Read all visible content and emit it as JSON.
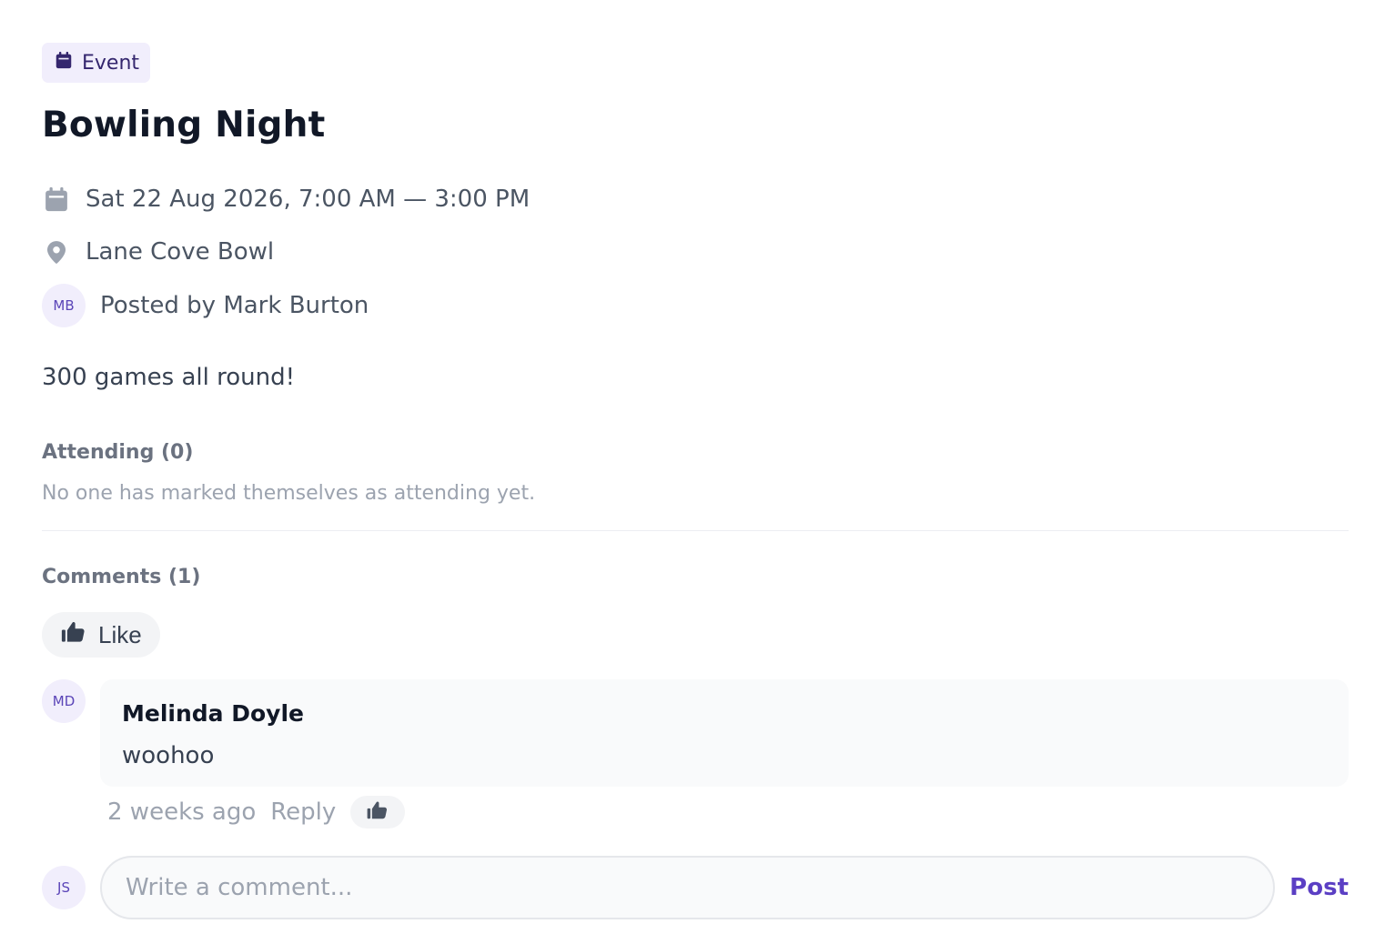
{
  "badge": {
    "label": "Event",
    "icon": "calendar-icon"
  },
  "event": {
    "title": "Bowling Night",
    "datetime": "Sat 22 Aug 2026, 7:00 AM — 3:00 PM",
    "location": "Lane Cove Bowl",
    "poster_initials": "MB",
    "posted_by": "Posted by Mark Burton",
    "description": "300 games all round!"
  },
  "attending": {
    "heading": "Attending (0)",
    "empty_text": "No one has marked themselves as attending yet."
  },
  "comments": {
    "heading": "Comments (1)",
    "like_label": "Like",
    "items": [
      {
        "initials": "MD",
        "author": "Melinda Doyle",
        "text": "woohoo",
        "time": "2 weeks ago",
        "reply_label": "Reply"
      }
    ]
  },
  "composer": {
    "initials": "JS",
    "placeholder": "Write a comment...",
    "post_label": "Post"
  },
  "colors": {
    "accent": "#5b3fc4",
    "badge_bg": "#f1eefc",
    "muted": "#9ca3af"
  }
}
